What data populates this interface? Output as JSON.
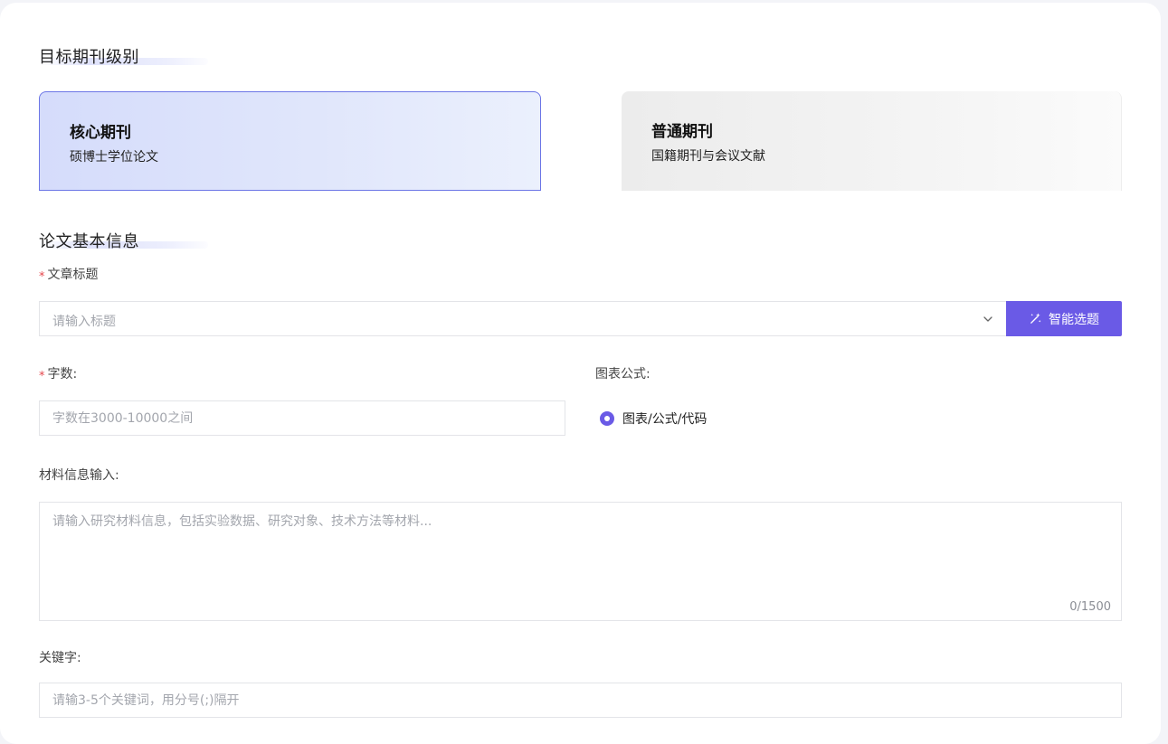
{
  "journal_level": {
    "section_title": "目标期刊级别",
    "cards": [
      {
        "title": "核心期刊",
        "subtitle": "硕博士学位论文",
        "selected": true
      },
      {
        "title": "普通期刊",
        "subtitle": "国籍期刊与会议文献",
        "selected": false
      }
    ]
  },
  "paper_info": {
    "section_title": "论文基本信息",
    "title_field": {
      "required_mark": "*",
      "label": "文章标题",
      "placeholder": "请输入标题"
    },
    "smart_button": {
      "label": "智能选题",
      "icon": "magic-wand-icon"
    },
    "word_count": {
      "required_mark": "*",
      "label": "字数:",
      "placeholder": "字数在3000-10000之间"
    },
    "charts": {
      "label": "图表公式:",
      "option_label": "图表/公式/代码",
      "checked": true
    },
    "material": {
      "label": "材料信息输入:",
      "placeholder": "请输入研究材料信息，包括实验数据、研究对象、技术方法等材料...",
      "counter": "0/1500"
    },
    "keywords": {
      "label": "关键字:",
      "placeholder": "请输3-5个关键词，用分号(;)隔开"
    }
  },
  "colors": {
    "accent": "#6a5ae6",
    "selected_border": "#6b75e6",
    "required": "#e5484d"
  }
}
